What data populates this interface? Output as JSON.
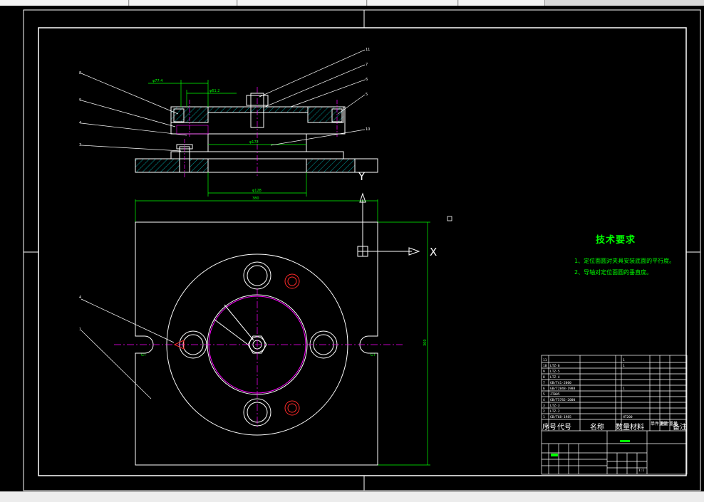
{
  "technical_requirements": {
    "title": "技术要求",
    "items": [
      "1、定位面圆对夹具安装底面的平行度。",
      "2、导轴对定位面圆的垂直度。"
    ]
  },
  "parts_table": {
    "header": [
      "序号",
      "代号",
      "名称",
      "数量",
      "材料",
      "单件重量",
      "总计重量",
      "备注"
    ],
    "rows": [
      [
        "11",
        "",
        "",
        "1",
        "45"
      ],
      [
        "10",
        "LTZ-6",
        "",
        "1",
        ""
      ],
      [
        "9",
        "LTZ-5",
        "",
        "1",
        ""
      ],
      [
        "8",
        "LTZ-4",
        "",
        "1",
        ""
      ],
      [
        "7",
        "GB/T41-2000",
        "",
        "",
        ""
      ],
      [
        "6",
        "GB/T2848-1988",
        "",
        "1",
        "45"
      ],
      [
        "5",
        "JT005",
        "",
        "1",
        ""
      ],
      [
        "4",
        "GB/T5782-2000",
        "",
        "",
        ""
      ],
      [
        "3",
        "LTZ-3",
        "",
        "1",
        ""
      ],
      [
        "2",
        "LTZ-2",
        "",
        "1",
        ""
      ],
      [
        "1",
        "GB/T68-1985",
        "",
        "1",
        "HT200"
      ]
    ],
    "sheet_text": "1:1"
  },
  "dimensions": {
    "dia_top": "φ77.4",
    "dia_mid": "φ61.2",
    "dia_bottom_mid": "φ128",
    "dia_base": "φ172",
    "width_total": "380",
    "height_total": "300",
    "label_gt": "GT"
  },
  "callouts": [
    "8",
    "9",
    "4",
    "3",
    "11",
    "7",
    "6",
    "5",
    "10",
    "4",
    "1"
  ],
  "ucs_axis_x": "X",
  "ucs_axis_y": "Y",
  "colors": {
    "background": "#000000",
    "line": "#ffffff",
    "dimension": "#00ff00",
    "center": "#ff00ff",
    "hatch": "#00ffff",
    "hole": "#ff0000",
    "text_annotation": "#00ff00"
  }
}
